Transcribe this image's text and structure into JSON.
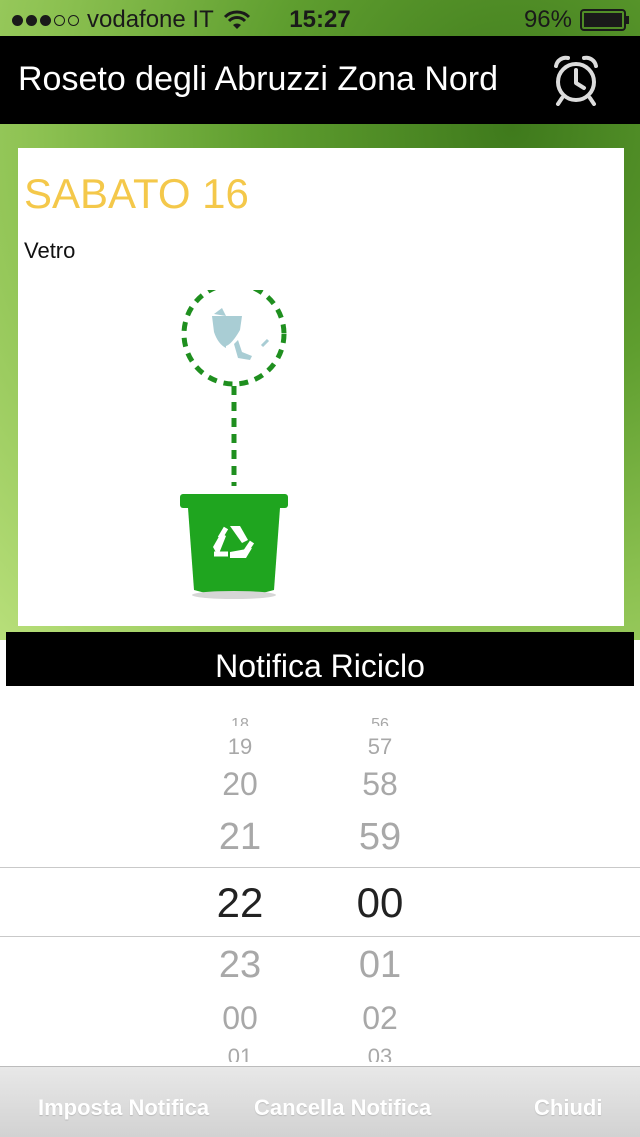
{
  "status_bar": {
    "carrier": "vodafone IT",
    "time": "15:27",
    "battery": "96%",
    "signal_strength": 3,
    "signal_max": 5,
    "battery_level": 0.96
  },
  "nav_bar": {
    "title": "Roseto degli Abruzzi Zona Nord",
    "alarm_icon": "alarm-clock-icon"
  },
  "card": {
    "day_title": "SABATO 16",
    "material": "Vetro",
    "illustration_icon": "glass-recycling-bin-icon"
  },
  "section": {
    "title": "Notifica Riciclo"
  },
  "picker": {
    "hours": [
      "18",
      "19",
      "20",
      "21",
      "22",
      "23",
      "00",
      "01"
    ],
    "minutes": [
      "56",
      "57",
      "58",
      "59",
      "00",
      "01",
      "02",
      "03"
    ],
    "selected_hour": "22",
    "selected_minute": "00"
  },
  "toolbar": {
    "set_label": "Imposta Notifica",
    "cancel_label": "Cancella Notifica",
    "close_label": "Chiudi"
  },
  "colors": {
    "accent_yellow": "#f4c84a",
    "bin_green": "#1fa51f",
    "bar_black": "#000000"
  }
}
